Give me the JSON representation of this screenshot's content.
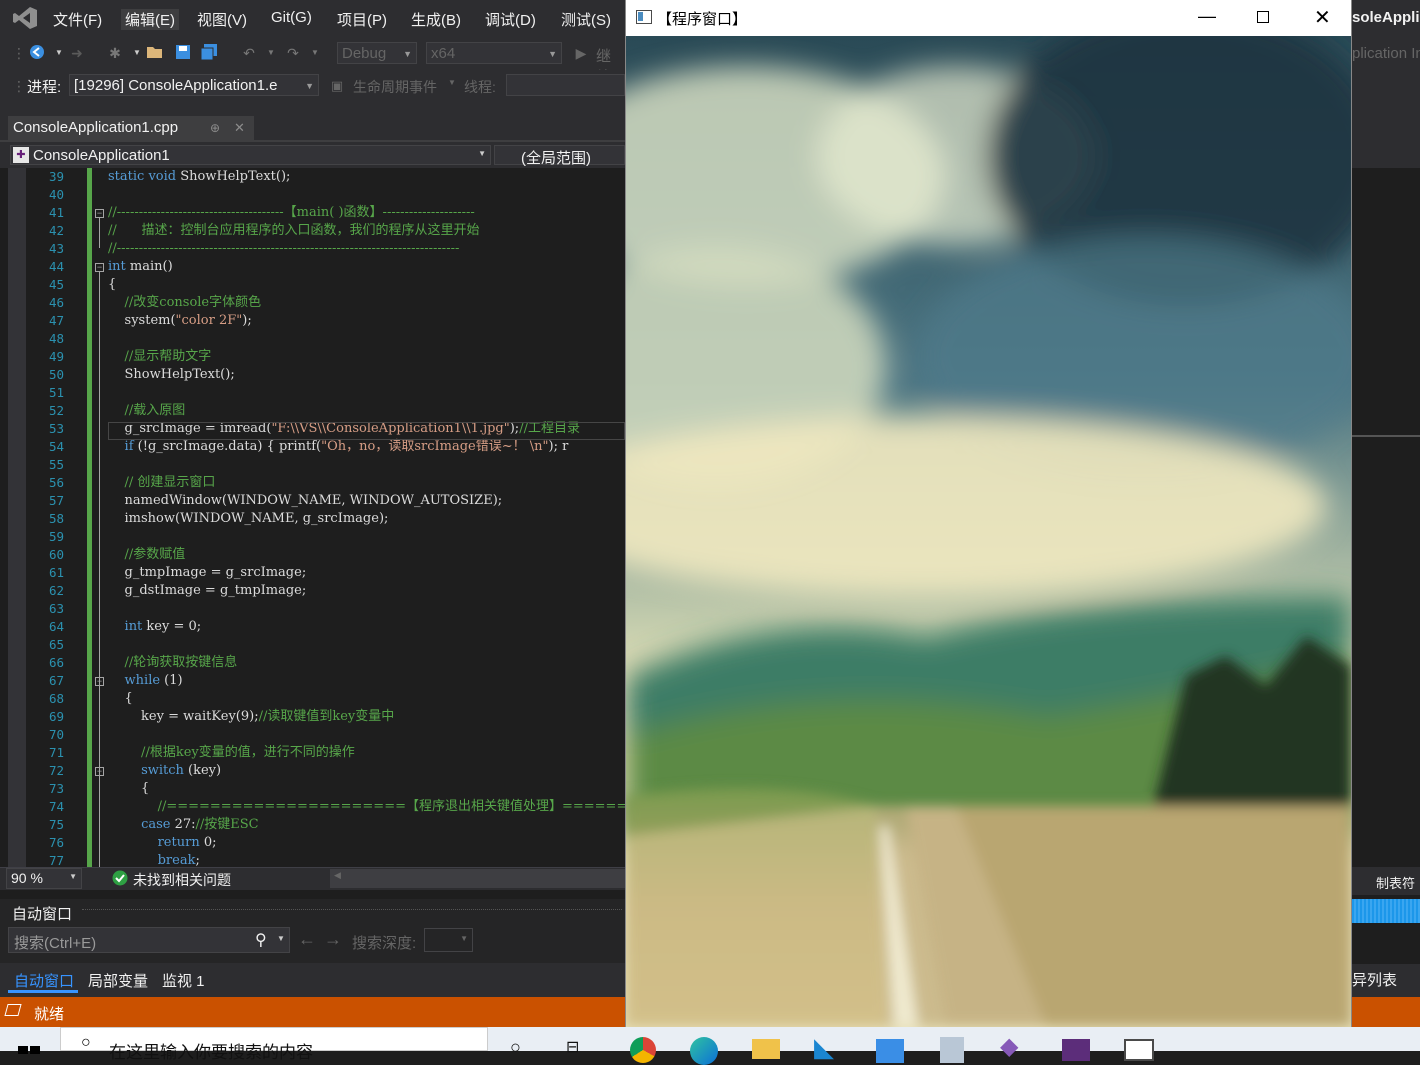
{
  "menu": [
    "文件(F)",
    "编辑(E)",
    "视图(V)",
    "Git(G)",
    "项目(P)",
    "生成(B)",
    "调试(D)",
    "测试(S)"
  ],
  "toolbar": {
    "config": "Debug",
    "platform": "x64",
    "continue_label": "继续",
    "process_label": "进程:",
    "process_value": "[19296] ConsoleApplication1.e",
    "lifecycle_label": "生命周期事件",
    "thread_label": "线程:"
  },
  "tab": {
    "file": "ConsoleApplication1.cpp",
    "pin": "⊕",
    "close": "✕"
  },
  "nav": {
    "project": "ConsoleApplication1",
    "scope": "(全局范围)"
  },
  "code": [
    {
      "n": "39",
      "t": "static void ShowHelpText();"
    },
    {
      "n": "40",
      "t": ""
    },
    {
      "n": "41",
      "t": "//--------------------------------------【main( )函数】---------------------"
    },
    {
      "n": "42",
      "t": "//      描述：控制台应用程序的入口函数，我们的程序从这里开始"
    },
    {
      "n": "43",
      "t": "//------------------------------------------------------------------------------"
    },
    {
      "n": "44",
      "t": "int main()"
    },
    {
      "n": "45",
      "t": "{"
    },
    {
      "n": "46",
      "t": "    //改变console字体颜色"
    },
    {
      "n": "47",
      "t": "    system(\"color 2F\");"
    },
    {
      "n": "48",
      "t": ""
    },
    {
      "n": "49",
      "t": "    //显示帮助文字"
    },
    {
      "n": "50",
      "t": "    ShowHelpText();"
    },
    {
      "n": "51",
      "t": ""
    },
    {
      "n": "52",
      "t": "    //载入原图"
    },
    {
      "n": "53",
      "t": "    g_srcImage = imread(\"F:\\\\VS\\\\ConsoleApplication1\\\\1.jpg\");//工程目录"
    },
    {
      "n": "54",
      "t": "    if (!g_srcImage.data) { printf(\"Oh，no，读取srcImage错误~！ \\n\"); r"
    },
    {
      "n": "55",
      "t": ""
    },
    {
      "n": "56",
      "t": "    // 创建显示窗口"
    },
    {
      "n": "57",
      "t": "    namedWindow(WINDOW_NAME, WINDOW_AUTOSIZE);"
    },
    {
      "n": "58",
      "t": "    imshow(WINDOW_NAME, g_srcImage);"
    },
    {
      "n": "59",
      "t": ""
    },
    {
      "n": "60",
      "t": "    //参数赋值"
    },
    {
      "n": "61",
      "t": "    g_tmpImage = g_srcImage;"
    },
    {
      "n": "62",
      "t": "    g_dstImage = g_tmpImage;"
    },
    {
      "n": "63",
      "t": ""
    },
    {
      "n": "64",
      "t": "    int key = 0;"
    },
    {
      "n": "65",
      "t": ""
    },
    {
      "n": "66",
      "t": "    //轮询获取按键信息"
    },
    {
      "n": "67",
      "t": "    while (1)"
    },
    {
      "n": "68",
      "t": "    {"
    },
    {
      "n": "69",
      "t": "        key = waitKey(9);//读取键值到key变量中"
    },
    {
      "n": "70",
      "t": ""
    },
    {
      "n": "71",
      "t": "        //根据key变量的值，进行不同的操作"
    },
    {
      "n": "72",
      "t": "        switch (key)"
    },
    {
      "n": "73",
      "t": "        {"
    },
    {
      "n": "74",
      "t": "            //======================【程序退出相关键值处理】==========="
    },
    {
      "n": "75",
      "t": "        case 27://按键ESC"
    },
    {
      "n": "76",
      "t": "            return 0;"
    },
    {
      "n": "77",
      "t": "            break;"
    }
  ],
  "editor_status": {
    "zoom": "90 %",
    "issues": "未找到相关问题"
  },
  "autos": {
    "title": "自动窗口",
    "search_placeholder": "搜索(Ctrl+E)",
    "depth_label": "搜索深度:",
    "tabs": [
      "自动窗口",
      "局部变量",
      "监视 1"
    ]
  },
  "status": {
    "ready": "就绪"
  },
  "image_window": {
    "title": "【程序窗口】"
  },
  "right": {
    "title": "soleAppli",
    "text1": "plication In",
    "text2": "制表符",
    "text3": "异列表"
  },
  "taskbar": {
    "search_placeholder": "在这里输入你要搜索的内容"
  }
}
